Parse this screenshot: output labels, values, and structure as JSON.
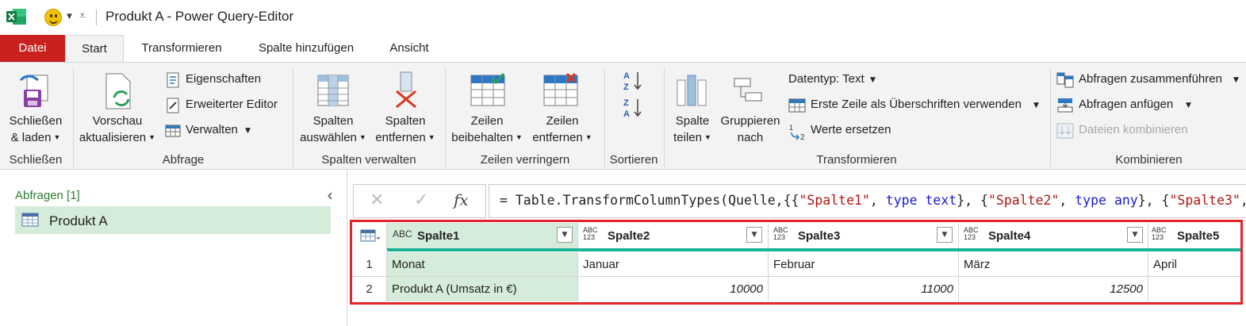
{
  "window": {
    "title": "Produkt A - Power Query-Editor"
  },
  "tabs": [
    {
      "label": "Datei"
    },
    {
      "label": "Start"
    },
    {
      "label": "Transformieren"
    },
    {
      "label": "Spalte hinzufügen"
    },
    {
      "label": "Ansicht"
    }
  ],
  "ribbon": {
    "schliessen": {
      "button_line1": "Schließen",
      "button_line2": "& laden",
      "group": "Schließen"
    },
    "abfrage": {
      "vorschau_line1": "Vorschau",
      "vorschau_line2": "aktualisieren",
      "eigenschaften": "Eigenschaften",
      "erweiterter_editor": "Erweiterter Editor",
      "verwalten": "Verwalten",
      "group": "Abfrage"
    },
    "spalten": {
      "auswaehlen_line1": "Spalten",
      "auswaehlen_line2": "auswählen",
      "entfernen_line1": "Spalten",
      "entfernen_line2": "entfernen",
      "group": "Spalten verwalten"
    },
    "zeilen": {
      "beibehalten_line1": "Zeilen",
      "beibehalten_line2": "beibehalten",
      "entfernen_line1": "Zeilen",
      "entfernen_line2": "entfernen",
      "group": "Zeilen verringern"
    },
    "sortieren": {
      "group": "Sortieren"
    },
    "transformieren": {
      "teilen_line1": "Spalte",
      "teilen_line2": "teilen",
      "gruppieren_line1": "Gruppieren",
      "gruppieren_line2": "nach",
      "datentyp": "Datentyp: Text",
      "erste_zeile": "Erste Zeile als Überschriften verwenden",
      "werte_ersetzen": "Werte ersetzen",
      "group": "Transformieren"
    },
    "kombinieren": {
      "zusammenfuehren": "Abfragen zusammenführen",
      "anfuegen": "Abfragen anfügen",
      "dateien": "Dateien kombinieren",
      "group": "Kombinieren"
    }
  },
  "queries_pane": {
    "header": "Abfragen [1]",
    "items": [
      {
        "label": "Produkt A"
      }
    ]
  },
  "formula_bar": {
    "fx": "fx",
    "prefix": "= Table.TransformColumnTypes(Quelle,{{",
    "s1": "\"Spalte1\"",
    "t1a": "type",
    "t1b": "text",
    "s2": "\"Spalte2\"",
    "t2a": "type",
    "t2b": "any",
    "s3": "\"Spalte3\""
  },
  "grid": {
    "columns": [
      {
        "name": "Spalte1",
        "type": "ABC"
      },
      {
        "name": "Spalte2",
        "type": "ABC 123"
      },
      {
        "name": "Spalte3",
        "type": "ABC 123"
      },
      {
        "name": "Spalte4",
        "type": "ABC 123"
      },
      {
        "name": "Spalte5",
        "type": "ABC 123"
      }
    ],
    "rows": [
      {
        "num": "1",
        "cells": [
          "Monat",
          "Januar",
          "Februar",
          "März",
          "April"
        ]
      },
      {
        "num": "2",
        "cells": [
          "Produkt A (Umsatz in €)",
          "10000",
          "11000",
          "12500",
          ""
        ]
      }
    ]
  },
  "colors": {
    "file_tab": "#c9211e",
    "selection": "#d5ecda",
    "header_bar": "#1ab394",
    "highlight_border": "#e3242b"
  }
}
